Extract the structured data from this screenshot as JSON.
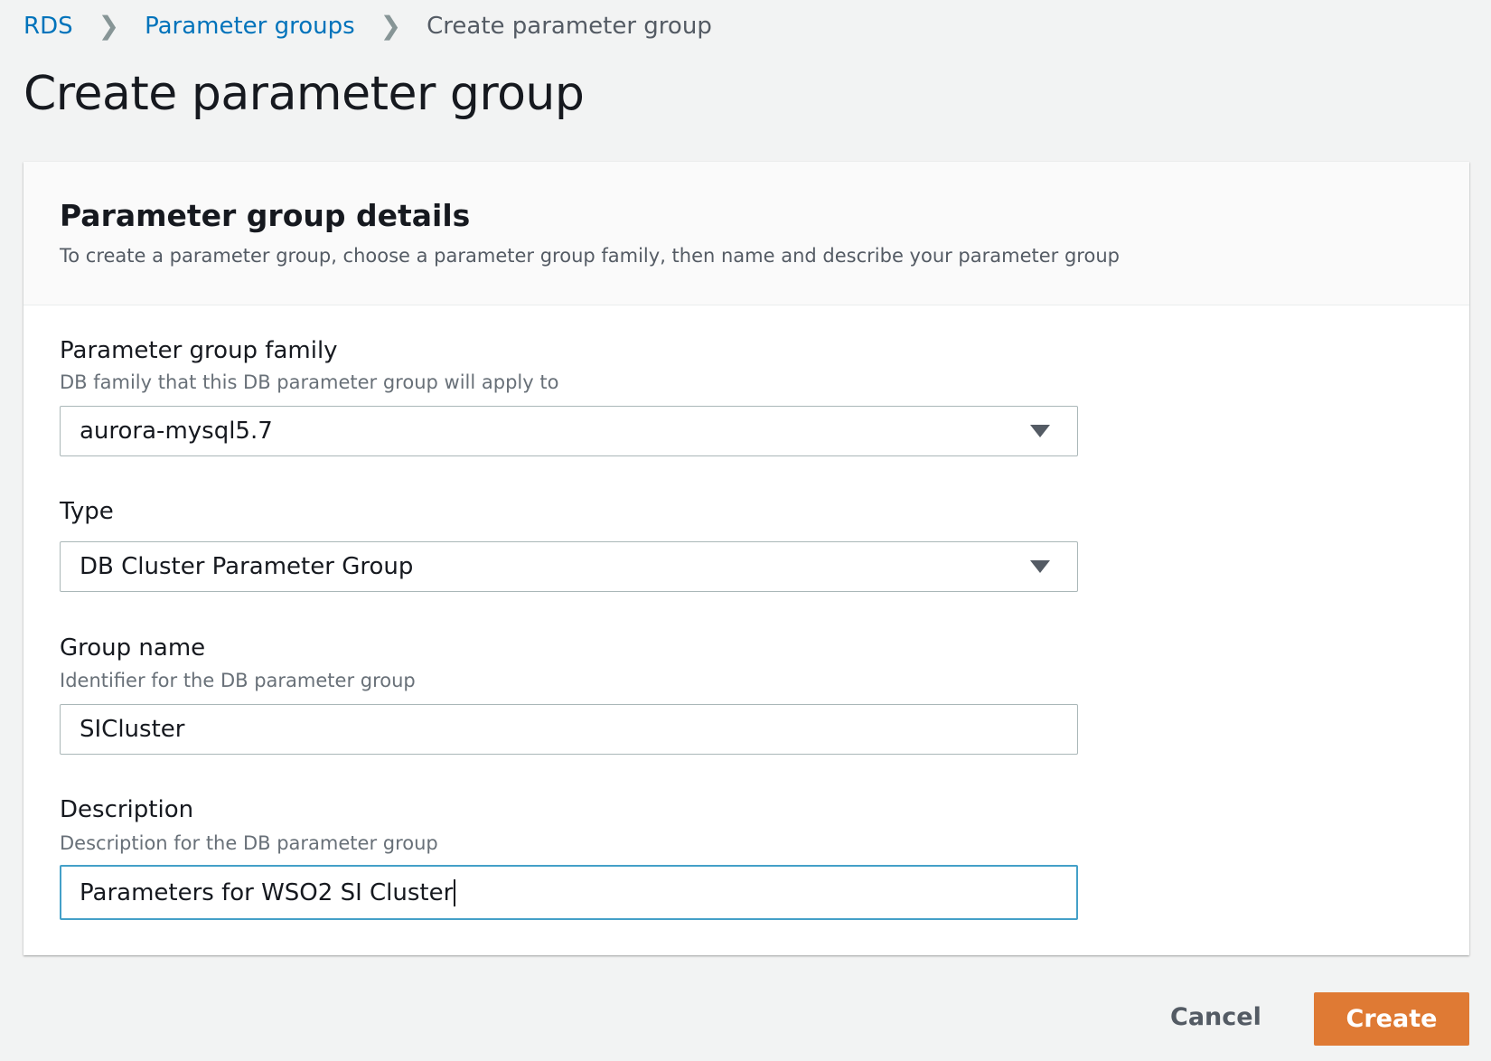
{
  "breadcrumb": {
    "items": [
      "RDS",
      "Parameter groups"
    ],
    "current": "Create parameter group"
  },
  "page_title": "Create parameter group",
  "card": {
    "title": "Parameter group details",
    "subtitle": "To create a parameter group, choose a parameter group family, then name and describe your parameter group"
  },
  "fields": {
    "family": {
      "label": "Parameter group family",
      "hint": "DB family that this DB parameter group will apply to",
      "value": "aurora-mysql5.7"
    },
    "type": {
      "label": "Type",
      "value": "DB Cluster Parameter Group"
    },
    "group_name": {
      "label": "Group name",
      "hint": "Identifier for the DB parameter group",
      "value": "SICluster"
    },
    "description": {
      "label": "Description",
      "hint": "Description for the DB parameter group",
      "value": "Parameters for WSO2 SI Cluster"
    }
  },
  "actions": {
    "cancel": "Cancel",
    "create": "Create"
  },
  "colors": {
    "accent": "#df7a34",
    "link": "#0073bb",
    "focus": "#44a0c8"
  }
}
